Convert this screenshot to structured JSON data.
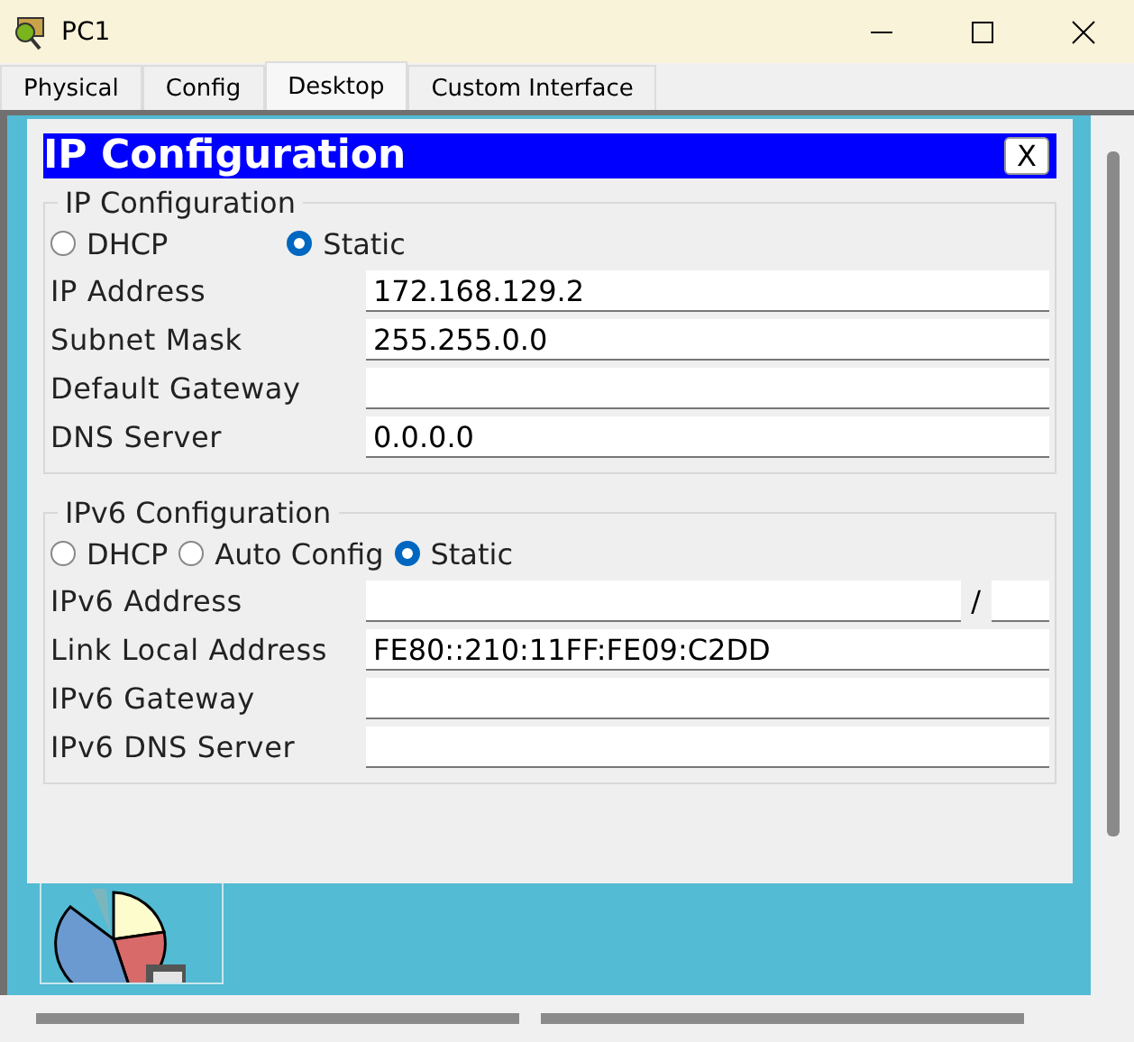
{
  "window": {
    "title": "PC1"
  },
  "tabs": [
    {
      "label": "Physical",
      "selected": false
    },
    {
      "label": "Config",
      "selected": false
    },
    {
      "label": "Desktop",
      "selected": true
    },
    {
      "label": "Custom Interface",
      "selected": false
    }
  ],
  "dialog": {
    "title": "IP Configuration",
    "close": "X",
    "sections": [
      {
        "legend": "IP Configuration",
        "modes": [
          {
            "label": "DHCP",
            "selected": false
          },
          {
            "label": "Static",
            "selected": true
          }
        ],
        "fields": [
          {
            "label": "IP Address",
            "value": "172.168.129.2"
          },
          {
            "label": "Subnet Mask",
            "value": "255.255.0.0"
          },
          {
            "label": "Default Gateway"
          },
          {
            "label": "DNS Server",
            "value": "0.0.0.0"
          }
        ]
      },
      {
        "legend": "IPv6 Configuration",
        "modes": [
          {
            "label": "DHCP",
            "selected": false
          },
          {
            "label": "Auto Config",
            "selected": false
          },
          {
            "label": "Static",
            "selected": true
          }
        ],
        "fields": [
          {
            "label": "IPv6 Address",
            "kind": "prefix",
            "separator": "/"
          },
          {
            "label": "Link Local Address",
            "value": "FE80::210:11FF:FE09:C2DD"
          },
          {
            "label": "IPv6 Gateway"
          },
          {
            "label": "IPv6 DNS Server"
          }
        ]
      }
    ]
  }
}
